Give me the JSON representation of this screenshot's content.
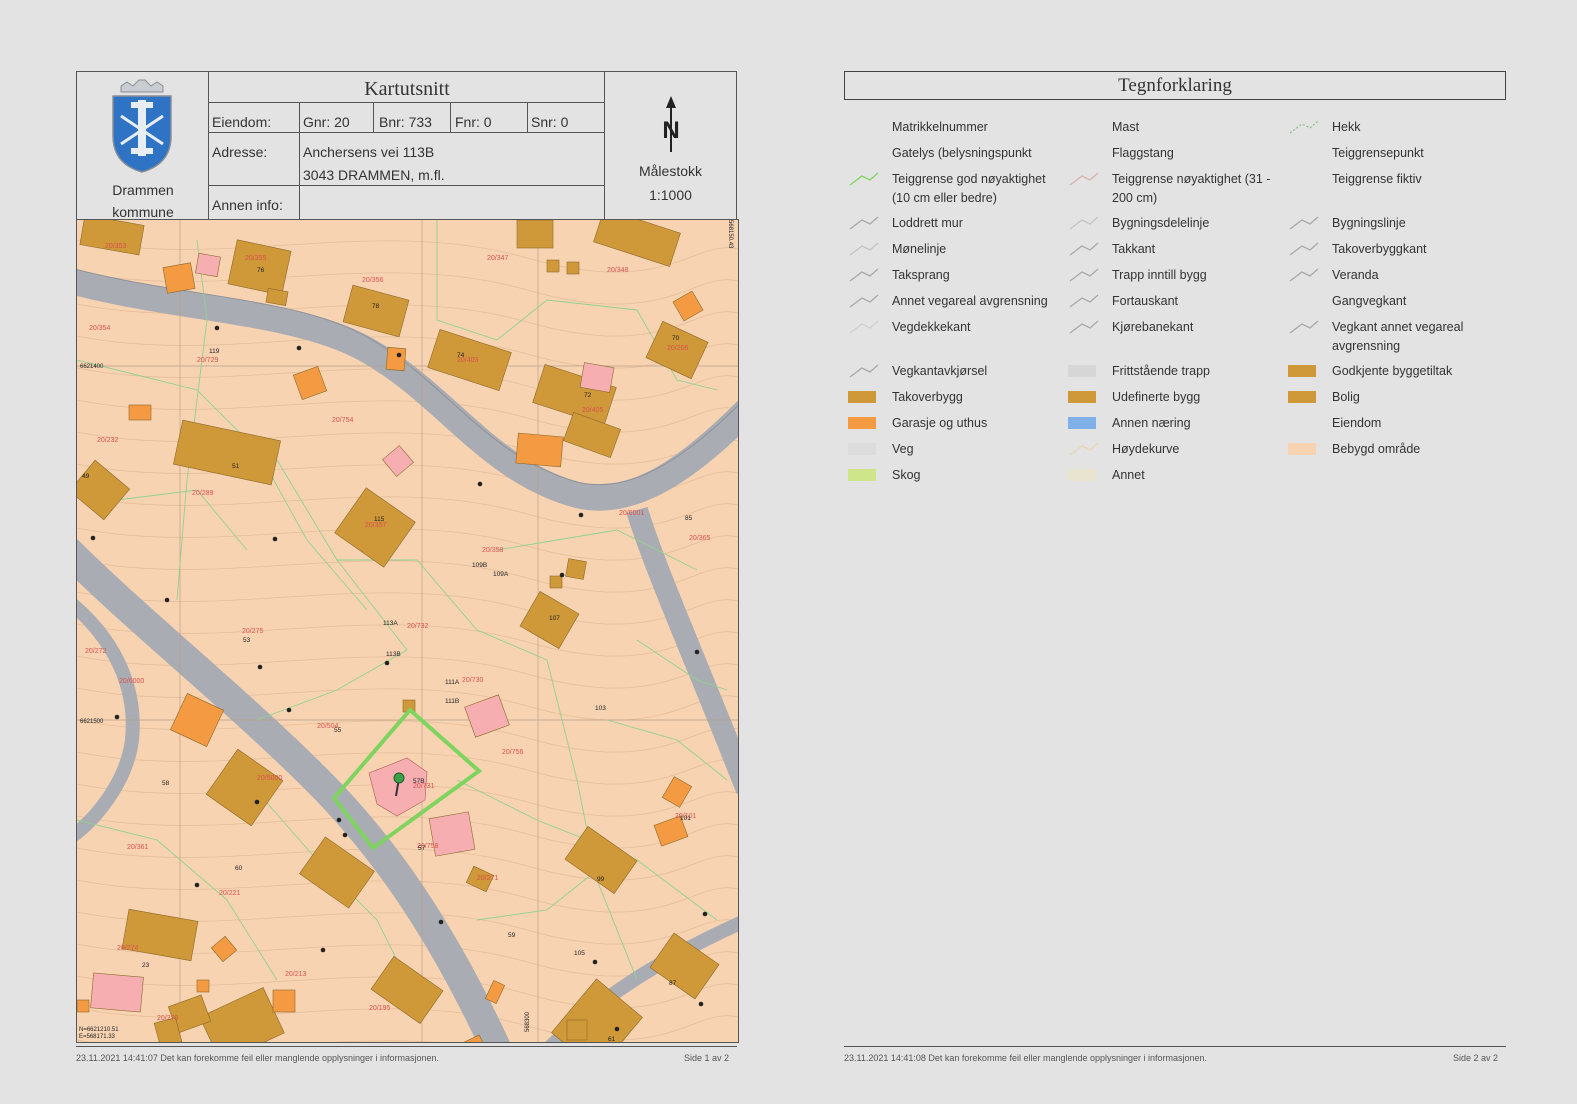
{
  "page1": {
    "title": "Kartutsnitt",
    "municipality": [
      "Drammen",
      "kommune"
    ],
    "eiendom_label": "Eiendom:",
    "gnr": "Gnr: 20",
    "bnr": "Bnr: 733",
    "fnr": "Fnr: 0",
    "snr": "Snr: 0",
    "adresse_label": "Adresse:",
    "address_line1": "Anchersens vei 113B",
    "address_line2": "3043 DRAMMEN, m.fl.",
    "annen_info_label": "Annen info:",
    "north_letter": "N",
    "scale_label": "Målestokk",
    "scale_value": "1:1000",
    "footer_left": "23.11.2021 14:41:07 Det kan forekomme feil eller manglende opplysninger i informasjonen.",
    "footer_right": "Side 1 av 2"
  },
  "map": {
    "colors": {
      "background": "#f7d3b2",
      "road": "#a9adb3",
      "bolig": "#cf9838",
      "garasje": "#f39a43",
      "godkjent": "#f6aeb0",
      "selected_parcel": "#7fd45f",
      "boundary": "#8fd28f"
    },
    "parcel_labels": [
      "20/353",
      "20/355",
      "20/356",
      "20/347",
      "20/348",
      "20/354",
      "20/729",
      "20/403",
      "20/206",
      "20/232",
      "20/754",
      "20/405",
      "20/289",
      "20/357",
      "20/6001",
      "20/365",
      "20/358",
      "20/732",
      "20/272",
      "20/6000",
      "20/275",
      "20/730",
      "20/756",
      "20/504",
      "20/5000",
      "20/731",
      "20/361",
      "20/758",
      "20/221",
      "20/271",
      "20/101",
      "20/274",
      "20/213",
      "20/195",
      "20/279"
    ],
    "house_numbers": [
      "76",
      "78",
      "74",
      "70",
      "72",
      "119",
      "51",
      "49",
      "115",
      "109B",
      "109A",
      "107",
      "113A",
      "113B",
      "53",
      "111A",
      "111B",
      "103",
      "55",
      "57B",
      "58",
      "60",
      "57",
      "101",
      "99",
      "59",
      "23",
      "61",
      "87",
      "85",
      "105"
    ],
    "coordinate_labels": [
      "6621400",
      "6621500",
      "N=6621210.51",
      "E=568171.33",
      "568150.43",
      "568300"
    ],
    "marker_icon": "map-pin-icon"
  },
  "page2": {
    "title": "Tegnforklaring",
    "footer_left": "23.11.2021 14:41:08 Det kan forekomme feil eller manglende opplysninger i informasjonen.",
    "footer_right": "Side 2 av 2",
    "legend": [
      {
        "label": "Matrikkelnummer",
        "sym": "none",
        "color": ""
      },
      {
        "label": "Mast",
        "sym": "none",
        "color": ""
      },
      {
        "label": "Hekk",
        "sym": "dotline",
        "color": "#8fc08f"
      },
      {
        "label": "Gatelys (belysningspunkt",
        "sym": "none",
        "color": ""
      },
      {
        "label": "Flaggstang",
        "sym": "none",
        "color": ""
      },
      {
        "label": "Teiggrensepunkt",
        "sym": "none",
        "color": ""
      },
      {
        "label": "Teiggrense god nøyaktighet (10 cm eller bedre)",
        "sym": "line",
        "color": "#7fd45f"
      },
      {
        "label": "Teiggrense nøyaktighet (31 - 200 cm)",
        "sym": "line",
        "color": "#d9b0b0"
      },
      {
        "label": "Teiggrense fiktiv",
        "sym": "none",
        "color": ""
      },
      {
        "label": "Loddrett mur",
        "sym": "line",
        "color": "#a8a8a8"
      },
      {
        "label": "Bygningsdelelinje",
        "sym": "line",
        "color": "#c4c4c4"
      },
      {
        "label": "Bygningslinje",
        "sym": "line",
        "color": "#a8a8a8"
      },
      {
        "label": "Mønelinje",
        "sym": "line",
        "color": "#c4c4c4"
      },
      {
        "label": "Takkant",
        "sym": "line",
        "color": "#a8a8a8"
      },
      {
        "label": "Takoverbyggkant",
        "sym": "line",
        "color": "#a8a8a8"
      },
      {
        "label": "Taksprang",
        "sym": "line",
        "color": "#a8a8a8"
      },
      {
        "label": "Trapp inntill bygg",
        "sym": "line",
        "color": "#a8a8a8"
      },
      {
        "label": "Veranda",
        "sym": "line",
        "color": "#a8a8a8"
      },
      {
        "label": "Annet vegareal avgrensning",
        "sym": "line",
        "color": "#a8a8a8"
      },
      {
        "label": "Fortauskant",
        "sym": "line",
        "color": "#a8a8a8"
      },
      {
        "label": "Gangvegkant",
        "sym": "none",
        "color": ""
      },
      {
        "label": "Vegdekkekant",
        "sym": "line",
        "color": "#d0d0d0"
      },
      {
        "label": "Kjørebanekant",
        "sym": "line",
        "color": "#a8a8a8"
      },
      {
        "label": "Vegkant annet vegareal avgrensning",
        "sym": "line",
        "color": "#a8a8a8"
      },
      {
        "label": "Vegkantavkjørsel",
        "sym": "line",
        "color": "#a8a8a8"
      },
      {
        "label": "Frittstående trapp",
        "sym": "fill",
        "color": "#d6d6d6"
      },
      {
        "label": "Godkjente byggetiltak",
        "sym": "fill",
        "color": "#cf9838"
      },
      {
        "label": "Takoverbygg",
        "sym": "fill",
        "color": "#cf9838"
      },
      {
        "label": "Udefinerte bygg",
        "sym": "fill",
        "color": "#cf9838"
      },
      {
        "label": "Bolig",
        "sym": "fill",
        "color": "#cf9838"
      },
      {
        "label": "Garasje og uthus",
        "sym": "fill",
        "color": "#f39a43"
      },
      {
        "label": "Annen næring",
        "sym": "fill",
        "color": "#7fb0e8"
      },
      {
        "label": "Eiendom",
        "sym": "none",
        "color": ""
      },
      {
        "label": "Veg",
        "sym": "fill",
        "color": "#dcdcdc"
      },
      {
        "label": "Høydekurve",
        "sym": "line",
        "color": "#e8d6b6"
      },
      {
        "label": "Bebygd område",
        "sym": "fill",
        "color": "#f7d3b2"
      },
      {
        "label": "Skog",
        "sym": "fill",
        "color": "#cfe58a"
      },
      {
        "label": "Annet",
        "sym": "fill",
        "color": "#e9e4cf"
      }
    ]
  }
}
